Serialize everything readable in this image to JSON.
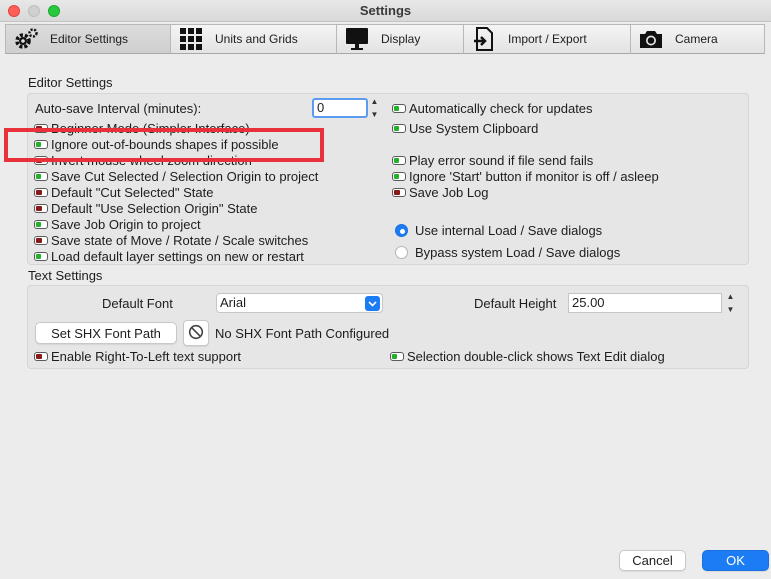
{
  "window": {
    "title": "Settings"
  },
  "tabs": [
    {
      "label": "Editor Settings",
      "icon": "gear-icon"
    },
    {
      "label": "Units and Grids",
      "icon": "grid-icon"
    },
    {
      "label": "Display",
      "icon": "monitor-icon"
    },
    {
      "label": "Import / Export",
      "icon": "import-export-icon"
    },
    {
      "label": "Camera",
      "icon": "camera-icon"
    }
  ],
  "editor_settings": {
    "heading": "Editor Settings",
    "autosave_label": "Auto-save Interval (minutes):",
    "autosave_value": "0",
    "left_options": [
      {
        "label": "Beginner Mode (Simpler Interface)",
        "state": "off"
      },
      {
        "label": "Ignore out-of-bounds shapes if possible",
        "state": "on"
      },
      {
        "label": "Invert mouse wheel zoom direction",
        "state": "off"
      },
      {
        "label": "Save Cut Selected / Selection Origin to project",
        "state": "on"
      },
      {
        "label": "Default \"Cut Selected\" State",
        "state": "off"
      },
      {
        "label": "Default \"Use Selection Origin\" State",
        "state": "off"
      },
      {
        "label": "Save Job Origin to project",
        "state": "on"
      },
      {
        "label": "Save state of Move / Rotate / Scale switches",
        "state": "off"
      },
      {
        "label": "Load default layer settings on new or restart",
        "state": "on"
      }
    ],
    "right_options": [
      {
        "label": "Automatically check for updates",
        "state": "on"
      },
      {
        "label": "Use System Clipboard",
        "state": "on"
      },
      {
        "label": "Play error sound if file send fails",
        "state": "on"
      },
      {
        "label": "Ignore 'Start' button if monitor is off / asleep",
        "state": "on"
      },
      {
        "label": "Save Job Log",
        "state": "off"
      }
    ],
    "dialog_options": [
      {
        "label": "Use internal Load / Save dialogs",
        "selected": true
      },
      {
        "label": "Bypass system Load / Save dialogs",
        "selected": false
      }
    ]
  },
  "text_settings": {
    "heading": "Text Settings",
    "default_font_label": "Default Font",
    "default_font_value": "Arial",
    "default_height_label": "Default Height",
    "default_height_value": "25.00",
    "shx_button": "Set SHX Font Path",
    "shx_status": "No SHX Font Path Configured",
    "rtl_label": "Enable Right-To-Left text support",
    "rtl_state": "off",
    "dblclick_label": "Selection double-click shows Text Edit dialog",
    "dblclick_state": "on"
  },
  "footer": {
    "cancel": "Cancel",
    "ok": "OK"
  },
  "colors": {
    "accent": "#1c7cf4",
    "toggle_on": "#22b22a",
    "toggle_off": "#8a1a1a",
    "annotation": "#e8313a"
  }
}
